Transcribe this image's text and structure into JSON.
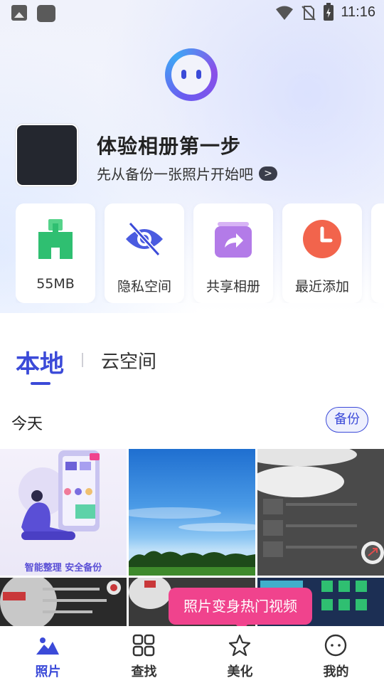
{
  "status_bar": {
    "time": "11:16"
  },
  "hero": {
    "title": "体验相册第一步",
    "subtitle": "先从备份一张照片开始吧"
  },
  "feature_cards": [
    {
      "label": "55MB",
      "icon": "broom-clean-icon",
      "color": "#2fbf71"
    },
    {
      "label": "隐私空间",
      "icon": "hidden-eye-icon",
      "color": "#3b4ad8"
    },
    {
      "label": "共享相册",
      "icon": "share-album-icon",
      "color": "#b37be8"
    },
    {
      "label": "最近添加",
      "icon": "clock-icon",
      "color": "#f2644c"
    }
  ],
  "tabs": {
    "local": "本地",
    "cloud": "云空间"
  },
  "section": {
    "date": "今天",
    "backup_label": "备份"
  },
  "photos": {
    "promo_caption": "智能整理 安全备份"
  },
  "tooltip": "照片变身热门视频",
  "bottom_nav": [
    {
      "label": "照片",
      "icon": "photo-mountain-icon",
      "active": true
    },
    {
      "label": "查找",
      "icon": "grid-icon",
      "active": false
    },
    {
      "label": "美化",
      "icon": "star-icon",
      "active": false
    },
    {
      "label": "我的",
      "icon": "smiley-icon",
      "active": false
    }
  ],
  "colors": {
    "accent": "#3b4ad8",
    "tooltip": "#f0438d"
  }
}
